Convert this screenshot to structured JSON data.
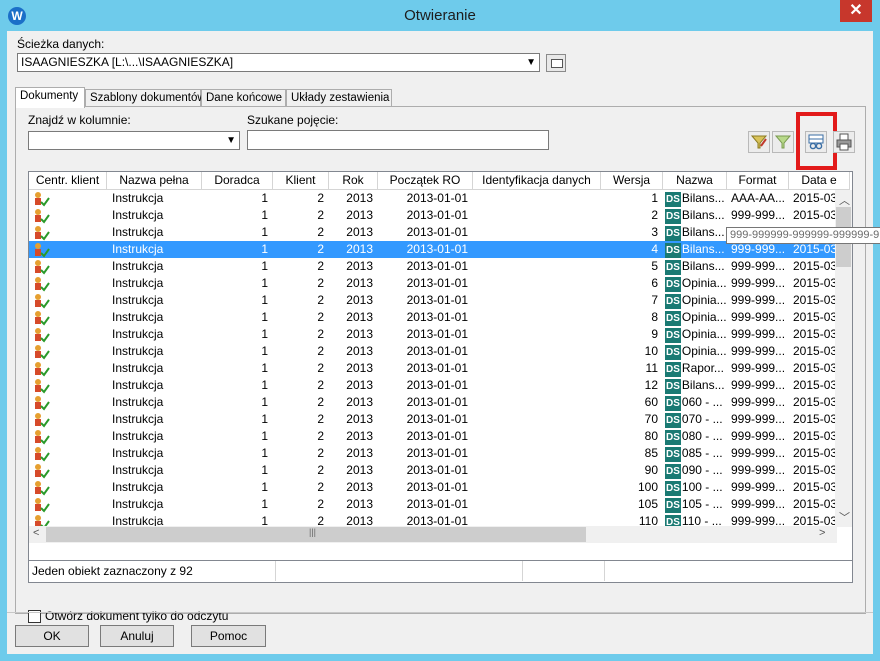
{
  "window": {
    "title": "Otwieranie",
    "app_icon": "W"
  },
  "path": {
    "label": "Ścieżka danych:",
    "value": "ISAAGNIESZKA [L:\\...\\ISAAGNIESZKA]"
  },
  "tabs": [
    "Dokumenty",
    "Szablony dokumentów",
    "Dane końcowe",
    "Układy zestawienia"
  ],
  "search": {
    "column_label": "Znajdź w kolumnie:",
    "column_value": "",
    "term_label": "Szukane pojęcie:",
    "term_value": ""
  },
  "columns": [
    "Centr. klient",
    "Nazwa pełna",
    "Doradca",
    "Klient",
    "Rok",
    "Początek RO",
    "Identyfikacja danych",
    "Wersja",
    "Nazwa",
    "Format",
    "Data e"
  ],
  "rows": [
    {
      "nazwa_pelna": "Instrukcja",
      "doradca": "1",
      "klient": "2",
      "rok": "2013",
      "poczatek": "2013-01-01",
      "ident": "",
      "wersja": "1",
      "badge": "DS",
      "nazwa": "Bilans...",
      "format": "AAA-AA...",
      "data": "2015-03-"
    },
    {
      "nazwa_pelna": "Instrukcja",
      "doradca": "1",
      "klient": "2",
      "rok": "2013",
      "poczatek": "2013-01-01",
      "ident": "",
      "wersja": "2",
      "badge": "DS",
      "nazwa": "Bilans...",
      "format": "999-999...",
      "data": "2015-03-"
    },
    {
      "nazwa_pelna": "Instrukcja",
      "doradca": "1",
      "klient": "2",
      "rok": "2013",
      "poczatek": "2013-01-01",
      "ident": "",
      "wersja": "3",
      "badge": "DS",
      "nazwa": "Bilans...",
      "format": "",
      "data": ""
    },
    {
      "nazwa_pelna": "Instrukcja",
      "doradca": "1",
      "klient": "2",
      "rok": "2013",
      "poczatek": "2013-01-01",
      "ident": "",
      "wersja": "4",
      "badge": "DS",
      "nazwa": "Bilans...",
      "format": "999-999...",
      "data": "2015-03-",
      "selected": true
    },
    {
      "nazwa_pelna": "Instrukcja",
      "doradca": "1",
      "klient": "2",
      "rok": "2013",
      "poczatek": "2013-01-01",
      "ident": "",
      "wersja": "5",
      "badge": "DS",
      "nazwa": "Bilans...",
      "format": "999-999...",
      "data": "2015-03-"
    },
    {
      "nazwa_pelna": "Instrukcja",
      "doradca": "1",
      "klient": "2",
      "rok": "2013",
      "poczatek": "2013-01-01",
      "ident": "",
      "wersja": "6",
      "badge": "DS",
      "nazwa": "Opinia...",
      "format": "999-999...",
      "data": "2015-03-"
    },
    {
      "nazwa_pelna": "Instrukcja",
      "doradca": "1",
      "klient": "2",
      "rok": "2013",
      "poczatek": "2013-01-01",
      "ident": "",
      "wersja": "7",
      "badge": "DS",
      "nazwa": "Opinia...",
      "format": "999-999...",
      "data": "2015-03-"
    },
    {
      "nazwa_pelna": "Instrukcja",
      "doradca": "1",
      "klient": "2",
      "rok": "2013",
      "poczatek": "2013-01-01",
      "ident": "",
      "wersja": "8",
      "badge": "DS",
      "nazwa": "Opinia...",
      "format": "999-999...",
      "data": "2015-03-"
    },
    {
      "nazwa_pelna": "Instrukcja",
      "doradca": "1",
      "klient": "2",
      "rok": "2013",
      "poczatek": "2013-01-01",
      "ident": "",
      "wersja": "9",
      "badge": "DS",
      "nazwa": "Opinia...",
      "format": "999-999...",
      "data": "2015-03-"
    },
    {
      "nazwa_pelna": "Instrukcja",
      "doradca": "1",
      "klient": "2",
      "rok": "2013",
      "poczatek": "2013-01-01",
      "ident": "",
      "wersja": "10",
      "badge": "DS",
      "nazwa": "Opinia...",
      "format": "999-999...",
      "data": "2015-03-"
    },
    {
      "nazwa_pelna": "Instrukcja",
      "doradca": "1",
      "klient": "2",
      "rok": "2013",
      "poczatek": "2013-01-01",
      "ident": "",
      "wersja": "11",
      "badge": "DS",
      "nazwa": "Rapor...",
      "format": "999-999...",
      "data": "2015-03-"
    },
    {
      "nazwa_pelna": "Instrukcja",
      "doradca": "1",
      "klient": "2",
      "rok": "2013",
      "poczatek": "2013-01-01",
      "ident": "",
      "wersja": "12",
      "badge": "DS",
      "nazwa": "Bilans...",
      "format": "999-999...",
      "data": "2015-03-"
    },
    {
      "nazwa_pelna": "Instrukcja",
      "doradca": "1",
      "klient": "2",
      "rok": "2013",
      "poczatek": "2013-01-01",
      "ident": "",
      "wersja": "60",
      "badge": "DS",
      "nazwa": "060 - ...",
      "format": "999-999...",
      "data": "2015-03-"
    },
    {
      "nazwa_pelna": "Instrukcja",
      "doradca": "1",
      "klient": "2",
      "rok": "2013",
      "poczatek": "2013-01-01",
      "ident": "",
      "wersja": "70",
      "badge": "DS",
      "nazwa": "070 - ...",
      "format": "999-999...",
      "data": "2015-03-"
    },
    {
      "nazwa_pelna": "Instrukcja",
      "doradca": "1",
      "klient": "2",
      "rok": "2013",
      "poczatek": "2013-01-01",
      "ident": "",
      "wersja": "80",
      "badge": "DS",
      "nazwa": "080 - ...",
      "format": "999-999...",
      "data": "2015-03-"
    },
    {
      "nazwa_pelna": "Instrukcja",
      "doradca": "1",
      "klient": "2",
      "rok": "2013",
      "poczatek": "2013-01-01",
      "ident": "",
      "wersja": "85",
      "badge": "DS",
      "nazwa": "085 - ...",
      "format": "999-999...",
      "data": "2015-03-"
    },
    {
      "nazwa_pelna": "Instrukcja",
      "doradca": "1",
      "klient": "2",
      "rok": "2013",
      "poczatek": "2013-01-01",
      "ident": "",
      "wersja": "90",
      "badge": "DS",
      "nazwa": "090 - ...",
      "format": "999-999...",
      "data": "2015-03-"
    },
    {
      "nazwa_pelna": "Instrukcja",
      "doradca": "1",
      "klient": "2",
      "rok": "2013",
      "poczatek": "2013-01-01",
      "ident": "",
      "wersja": "100",
      "badge": "DS",
      "nazwa": "100 - ...",
      "format": "999-999...",
      "data": "2015-03-"
    },
    {
      "nazwa_pelna": "Instrukcja",
      "doradca": "1",
      "klient": "2",
      "rok": "2013",
      "poczatek": "2013-01-01",
      "ident": "",
      "wersja": "105",
      "badge": "DS",
      "nazwa": "105 - ...",
      "format": "999-999...",
      "data": "2015-03-"
    },
    {
      "nazwa_pelna": "Instrukcja",
      "doradca": "1",
      "klient": "2",
      "rok": "2013",
      "poczatek": "2013-01-01",
      "ident": "",
      "wersja": "110",
      "badge": "DS",
      "nazwa": "110 - ...",
      "format": "999-999...",
      "data": "2015-03-"
    }
  ],
  "tooltip": "999-999999-999999-999999-9",
  "status": "Jeden obiekt zaznaczony z 92",
  "readonly_label": "Otwórz dokument tylko do odczytu",
  "buttons": {
    "ok": "OK",
    "cancel": "Anuluj",
    "help": "Pomoc"
  },
  "colors": {
    "selection": "#3399ff",
    "badge": "#1a7a73",
    "highlight": "#e21a1a",
    "titlebar": "#6ecbeb"
  }
}
